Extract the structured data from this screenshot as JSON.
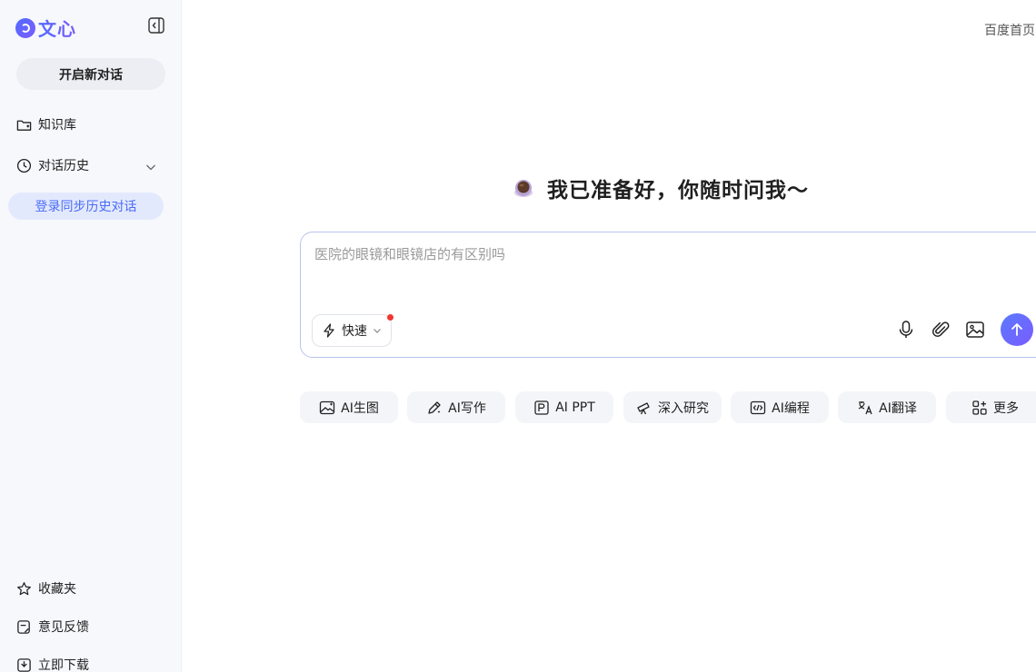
{
  "sidebar": {
    "logo_text": "文心",
    "new_chat_label": "开启新对话",
    "knowledge_label": "知识库",
    "history_label": "对话历史",
    "login_sync_label": "登录同步历史对话",
    "favorites_label": "收藏夹",
    "feedback_label": "意见反馈",
    "download_label": "立即下载"
  },
  "header": {
    "home_link": "百度首页"
  },
  "main": {
    "greeting": "我已准备好，你随时问我～",
    "input_placeholder": "医院的眼镜和眼镜店的有区别吗",
    "mode_label": "快速",
    "quick_actions": [
      {
        "label": "AI生图",
        "icon": "image-gen-icon"
      },
      {
        "label": "AI写作",
        "icon": "pen-icon"
      },
      {
        "label": "AI PPT",
        "icon": "ppt-icon"
      },
      {
        "label": "深入研究",
        "icon": "telescope-icon"
      },
      {
        "label": "AI编程",
        "icon": "code-icon"
      },
      {
        "label": "AI翻译",
        "icon": "translate-icon"
      },
      {
        "label": "更多",
        "icon": "grid-plus-icon"
      }
    ]
  },
  "colors": {
    "accent": "#4f6bff",
    "sidebar_bg": "#f7f8fc",
    "login_sync_bg": "#e3e9fd",
    "notification_dot": "#f2362f"
  }
}
